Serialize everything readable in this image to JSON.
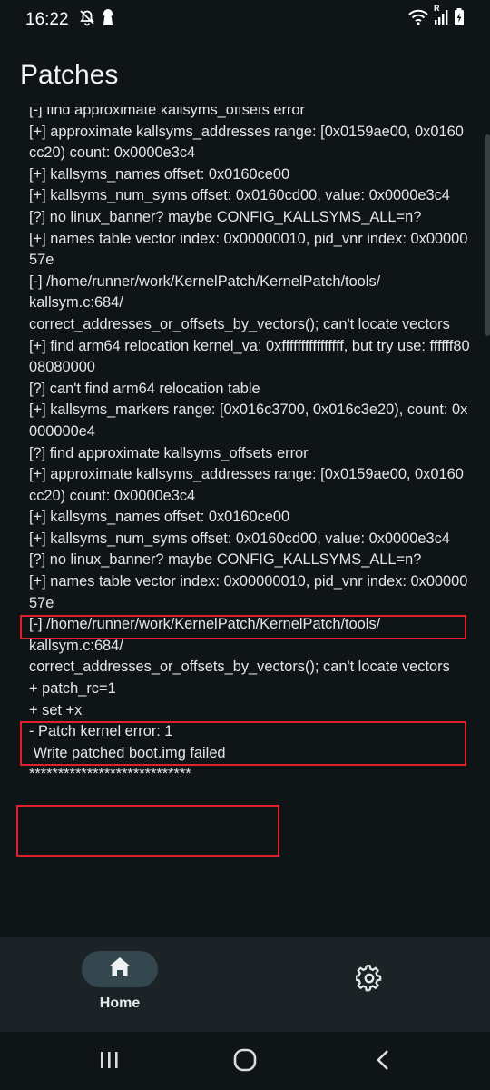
{
  "status": {
    "time": "16:22",
    "icons": [
      "dnd-off-icon",
      "keyhole-icon",
      "wifi-icon",
      "signal-icon",
      "battery-charging-icon"
    ],
    "signal_badge": "R"
  },
  "page_title": "Patches",
  "log_lines": [
    "[-] find approximate kallsyms_offsets error",
    "[+] approximate kallsyms_addresses range: [0x0159ae00, 0x0160cc20) count: 0x0000e3c4",
    "[+] kallsyms_names offset: 0x0160ce00",
    "[+] kallsyms_num_syms offset: 0x0160cd00, value: 0x0000e3c4",
    "[?] no linux_banner? maybe CONFIG_KALLSYMS_ALL=n?",
    "[+] names table vector index: 0x00000010, pid_vnr index: 0x0000057e",
    "[-] /home/runner/work/KernelPatch/KernelPatch/tools/",
    "kallsym.c:684/",
    "correct_addresses_or_offsets_by_vectors(); can't locate vectors",
    "[+] find arm64 relocation kernel_va: 0xffffffffffffffff, but try use: ffffff8008080000",
    "[?] can't find arm64 relocation table",
    "[+] kallsyms_markers range: [0x016c3700, 0x016c3e20), count: 0x000000e4",
    "[?] find approximate kallsyms_offsets error",
    "[+] approximate kallsyms_addresses range: [0x0159ae00, 0x0160cc20) count: 0x0000e3c4",
    "[+] kallsyms_names offset: 0x0160ce00",
    "[+] kallsyms_num_syms offset: 0x0160cd00, value: 0x0000e3c4",
    "[?] no linux_banner? maybe CONFIG_KALLSYMS_ALL=n?",
    "[+] names table vector index: 0x00000010, pid_vnr index: 0x0000057e",
    "[-] /home/runner/work/KernelPatch/KernelPatch/tools/",
    "kallsym.c:684/",
    "correct_addresses_or_offsets_by_vectors(); can't locate vectors",
    "+ patch_rc=1",
    "+ set +x",
    "- Patch kernel error: 1",
    " Write patched boot.img failed",
    "****************************"
  ],
  "bottom_nav": {
    "home_label": "Home",
    "home_icon": "home-icon",
    "settings_icon": "gear-icon"
  },
  "system_nav": [
    "recents-icon",
    "home-circle-icon",
    "back-icon"
  ],
  "colors": {
    "background": "#0f1417",
    "highlight": "#e0212b",
    "nav_bar": "#1b2326",
    "nav_pill": "#34464e"
  }
}
